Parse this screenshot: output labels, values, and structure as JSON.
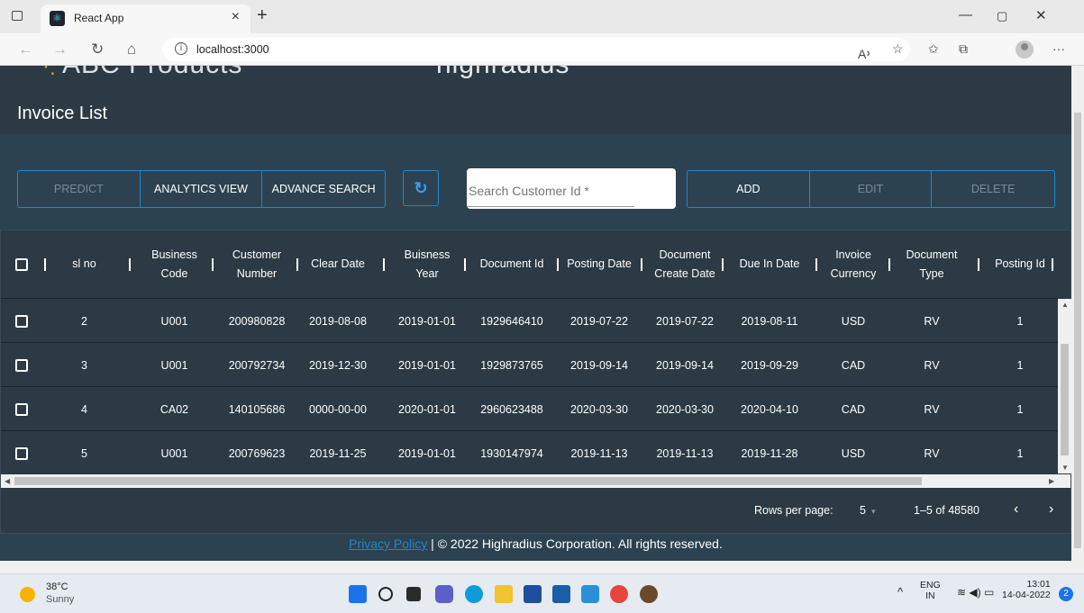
{
  "browser": {
    "tab_title": "React App",
    "url": "localhost:3000"
  },
  "app": {
    "logo_left": "ABC Products",
    "logo_right": "highradius",
    "page_title": "Invoice List",
    "buttons": {
      "predict": "PREDICT",
      "analytics": "ANALYTICS VIEW",
      "advance_search": "ADVANCE SEARCH",
      "add": "ADD",
      "edit": "EDIT",
      "delete": "DELETE"
    },
    "search_placeholder": "Search Customer Id *",
    "accent_color": "#1e88c8"
  },
  "table": {
    "headers": [
      [
        "sl no"
      ],
      [
        "Business",
        "Code"
      ],
      [
        "Customer",
        "Number"
      ],
      [
        "Clear Date"
      ],
      [
        "Buisness",
        "Year"
      ],
      [
        "Document Id"
      ],
      [
        "Posting Date"
      ],
      [
        "Document",
        "Create Date"
      ],
      [
        "Due In Date"
      ],
      [
        "Invoice",
        "Currency"
      ],
      [
        "Document",
        "Type"
      ],
      [
        "Posting Id"
      ]
    ],
    "rows": [
      [
        "2",
        "U001",
        "200980828",
        "2019-08-08",
        "2019-01-01",
        "1929646410",
        "2019-07-22",
        "2019-07-22",
        "2019-08-11",
        "USD",
        "RV",
        "1"
      ],
      [
        "3",
        "U001",
        "200792734",
        "2019-12-30",
        "2019-01-01",
        "1929873765",
        "2019-09-14",
        "2019-09-14",
        "2019-09-29",
        "CAD",
        "RV",
        "1"
      ],
      [
        "4",
        "CA02",
        "140105686",
        "0000-00-00",
        "2020-01-01",
        "2960623488",
        "2020-03-30",
        "2020-03-30",
        "2020-04-10",
        "CAD",
        "RV",
        "1"
      ],
      [
        "5",
        "U001",
        "200769623",
        "2019-11-25",
        "2019-01-01",
        "1930147974",
        "2019-11-13",
        "2019-11-13",
        "2019-11-28",
        "USD",
        "RV",
        "1"
      ]
    ]
  },
  "pagination": {
    "rows_label": "Rows per page:",
    "rows_value": "5",
    "range": "1–5 of 48580"
  },
  "footer": {
    "link": "Privacy Policy",
    "text": " | © 2022 Highradius Corporation. All rights reserved."
  },
  "taskbar": {
    "temperature": "38°C",
    "condition": "Sunny",
    "lang_top": "ENG",
    "lang_bottom": "IN",
    "time": "13:01",
    "date": "14-04-2022",
    "notifications": "2"
  }
}
